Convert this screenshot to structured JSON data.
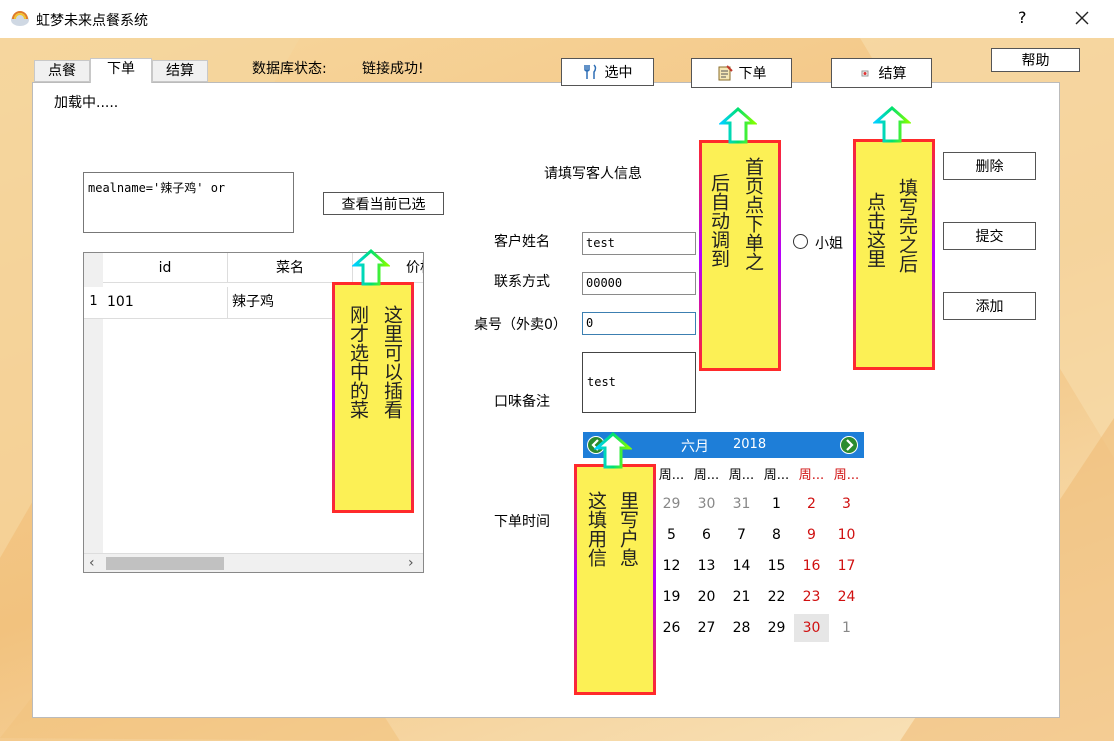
{
  "window": {
    "title": "虹梦未来点餐系统",
    "help_glyph": "?",
    "close_glyph": "✕"
  },
  "tabs": [
    {
      "label": "点餐"
    },
    {
      "label": "下单"
    },
    {
      "label": "结算"
    }
  ],
  "db": {
    "label": "数据库状态:",
    "status": "链接成功!"
  },
  "toolbar": {
    "select_label": "选中",
    "order_label": "下单",
    "checkout_label": "结算",
    "help_label": "帮助"
  },
  "main": {
    "loading_text": "加载中.....",
    "sql_text": "mealname='辣子鸡' or",
    "view_selected_label": "查看当前已选",
    "grid": {
      "headers": [
        "id",
        "菜名",
        "价格"
      ],
      "rows": [
        {
          "num": "1",
          "id": "101",
          "name": "辣子鸡"
        }
      ]
    }
  },
  "form": {
    "heading": "请填写客人信息",
    "name_label": "客户姓名",
    "name_value": "test",
    "contact_label": "联系方式",
    "contact_value": "00000",
    "table_label": "桌号（外卖0）",
    "table_value": "0",
    "taste_label": "口味备注",
    "taste_value": "test",
    "time_label": "下单时间",
    "radio_label": "小姐"
  },
  "actions": {
    "delete_label": "删除",
    "submit_label": "提交",
    "add_label": "添加"
  },
  "calendar": {
    "month": "六月",
    "year": "2018",
    "weekdays": [
      "周...",
      "周...",
      "周...",
      "周...",
      "周...",
      "周..."
    ],
    "weeks": [
      [
        "29",
        "30",
        "31",
        "1",
        "2",
        "3"
      ],
      [
        "5",
        "6",
        "7",
        "8",
        "9",
        "10"
      ],
      [
        "12",
        "13",
        "14",
        "15",
        "16",
        "17"
      ],
      [
        "19",
        "20",
        "21",
        "22",
        "23",
        "24"
      ],
      [
        "26",
        "27",
        "28",
        "29",
        "30",
        "1"
      ]
    ],
    "selected": "30"
  },
  "notes": {
    "grid_note": [
      "这里可以插看",
      "刚才选中的菜"
    ],
    "order_note": [
      "首页点下单之",
      "后自动调到"
    ],
    "submit_note": [
      "填写完之后",
      "点击这里"
    ],
    "calendar_note": [
      "里写户息",
      "这填用信"
    ]
  },
  "colors": {
    "accent_blue": "#1e7ed8",
    "note_yellow": "#fcf055",
    "weekend_red": "#d01010"
  }
}
